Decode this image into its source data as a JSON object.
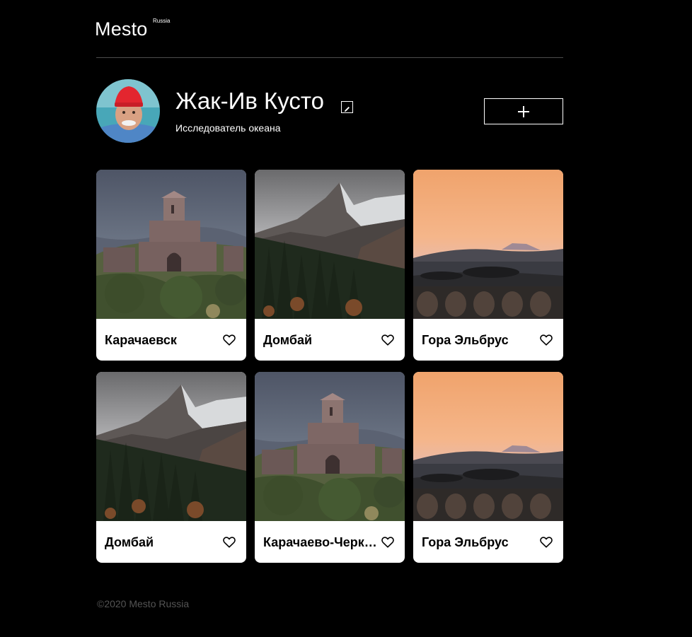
{
  "header": {
    "logo": "Mesto",
    "logo_sup": "Russia"
  },
  "profile": {
    "name": "Жак-Ив Кусто",
    "about": "Исследователь океана"
  },
  "cards": [
    {
      "title": "Карачаевск",
      "image": "church"
    },
    {
      "title": "Домбай",
      "image": "mountain"
    },
    {
      "title": "Гора Эльбрус",
      "image": "sunset"
    },
    {
      "title": "Домбай",
      "image": "mountain"
    },
    {
      "title": "Карачаево-Черкесия",
      "image": "church"
    },
    {
      "title": "Гора Эльбрус",
      "image": "sunset"
    }
  ],
  "footer": {
    "copyright": "©2020 Mesto Russia"
  },
  "icons": {
    "edit": "pencil-icon",
    "add": "plus-icon",
    "like": "heart-outline-icon"
  },
  "colors": {
    "background": "#000000",
    "card": "#ffffff",
    "footer_text": "#545454",
    "divider": "#545454"
  }
}
